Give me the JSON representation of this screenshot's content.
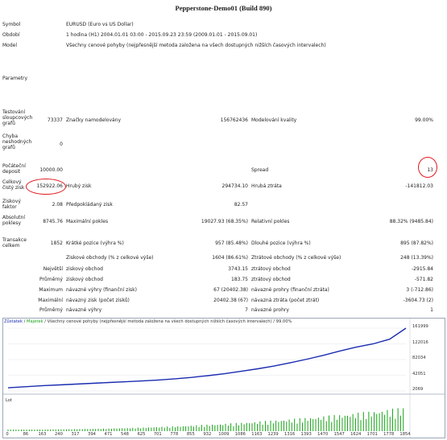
{
  "report": {
    "title": "Pepperstone-Demo01 (Build 890)",
    "symbol_label": "Symbol",
    "symbol_value": "EURUSD (Euro vs US Dollar)",
    "period_label": "Období",
    "period_value": "1 hodina (H1) 2004.01.01 03:00 - 2015.09.23 23:59 (2009.01.01 - 2015.09.01)",
    "model_label": "Model",
    "model_value": "Všechny cenové pohyby (nejpřesnější metoda založena na všech dostupných nižších časových intervalech)",
    "params_label": "Parametry",
    "bars_label": "Testování sloupcových grafů",
    "bars_value": "73337",
    "ticks_label": "Značky namodelovány",
    "ticks_value": "156762436",
    "quality_label": "Modelování kvality",
    "quality_value": "99.00%",
    "mismatch_label": "Chyba neshodných grafů",
    "mismatch_value": "0",
    "deposit_label": "Počáteční deposit",
    "deposit_value": "10000.00",
    "spread_label": "Spread",
    "spread_value": "13",
    "netprofit_label": "Celkový čistý zisk",
    "netprofit_value": "152922.06",
    "grossprofit_label": "Hrubý zisk",
    "grossprofit_value": "294734.10",
    "grossloss_label": "Hrubá ztráta",
    "grossloss_value": "-141812.03",
    "profitfactor_label": "Ziskový faktor",
    "profitfactor_value": "2.08",
    "expected_label": "Předpokládaný zisk",
    "expected_value": "82.57",
    "absdd_label": "Absolutní poklesy",
    "absdd_value": "8745.76",
    "maxdd_label": "Maximální pokles",
    "maxdd_value": "19027.93 (68.35%)",
    "reldd_label": "Relativní pokles",
    "reldd_value": "88.32% (9485.84)",
    "trades_label": "Transakce celkem",
    "trades_value": "1852",
    "short_label": "Krátké pozice (výhra %)",
    "short_value": "957 (85.48%)",
    "long_label": "Dlouhé pozice (výhra %)",
    "long_value": "895 (87.82%)",
    "wins_label": "Ziskové obchody (% z celkové výše)",
    "wins_value": "1604 (86.61%)",
    "losses_label": "Ztrátové obchody (% z celkové výše)",
    "losses_value": "248 (13.39%)",
    "largest_label": "Největší",
    "largest_win_label": "ziskový obchod",
    "largest_win_value": "3743.15",
    "largest_loss_label": "ztrátový obchod",
    "largest_loss_value": "-2915.84",
    "avg_label": "Průměrný",
    "avg_win_label": "ziskový obchod",
    "avg_win_value": "183.75",
    "avg_loss_label": "ztrátový obchod",
    "avg_loss_value": "-571.82",
    "max_label": "Maximum",
    "max_consec_wins_label": "návazné výhry (finanční zisk)",
    "max_consec_wins_value": "67 (20402.38)",
    "max_consec_losses_label": "návazné prohry (finanční ztráta)",
    "max_consec_losses_value": "3 (-712.86)",
    "maximal_label": "Maximální",
    "maximal_profit_label": "návazný zisk (počet zisků)",
    "maximal_profit_value": "20402.38 (67)",
    "maximal_loss_label": "návazná ztráta (počet ztrát)",
    "maximal_loss_value": "-3604.73 (2)",
    "average_label": "Průměrný",
    "avg_consec_wins_label": "návazné výhry",
    "avg_consec_wins_value": "7",
    "avg_consec_losses_label": "návazné prohry",
    "avg_consec_losses_value": "1"
  },
  "chart_legend": {
    "balance": "Zůstatek",
    "sep": " / ",
    "equity": "Majetek",
    "rest": " / Všechny cenové pohyby (nejpřesnější metoda založena na všech dostupných nižších časových intervalech) / 99.00%"
  },
  "colors": {
    "balance": "#1a2cb0",
    "volume": "#17a317",
    "circle": "#e0161b"
  },
  "chart_data": {
    "type": "line",
    "title": "",
    "ylim": [
      2069,
      161999
    ],
    "yticks": [
      "161999",
      "122016",
      "82034",
      "42051",
      "2069"
    ],
    "xticks": [
      "0",
      "86",
      "163",
      "240",
      "317",
      "394",
      "471",
      "548",
      "625",
      "701",
      "778",
      "855",
      "932",
      "1009",
      "1086",
      "1163",
      "1239",
      "1316",
      "1393",
      "1470",
      "1547",
      "1624",
      "1701",
      "1778",
      "1854"
    ],
    "lot_label": "Lot",
    "series": [
      {
        "name": "Zůstatek",
        "x": [
          0,
          86,
          163,
          240,
          317,
          394,
          471,
          548,
          625,
          701,
          778,
          855,
          932,
          1009,
          1086,
          1163,
          1239,
          1316,
          1393,
          1470,
          1547,
          1624,
          1701,
          1778,
          1854
        ],
        "values": [
          10000,
          13000,
          15500,
          17500,
          19500,
          21500,
          23500,
          25500,
          27500,
          30000,
          33000,
          36500,
          41000,
          46000,
          52000,
          58500,
          65500,
          74000,
          83000,
          93000,
          104000,
          114000,
          122000,
          134000,
          162000
        ]
      }
    ]
  }
}
